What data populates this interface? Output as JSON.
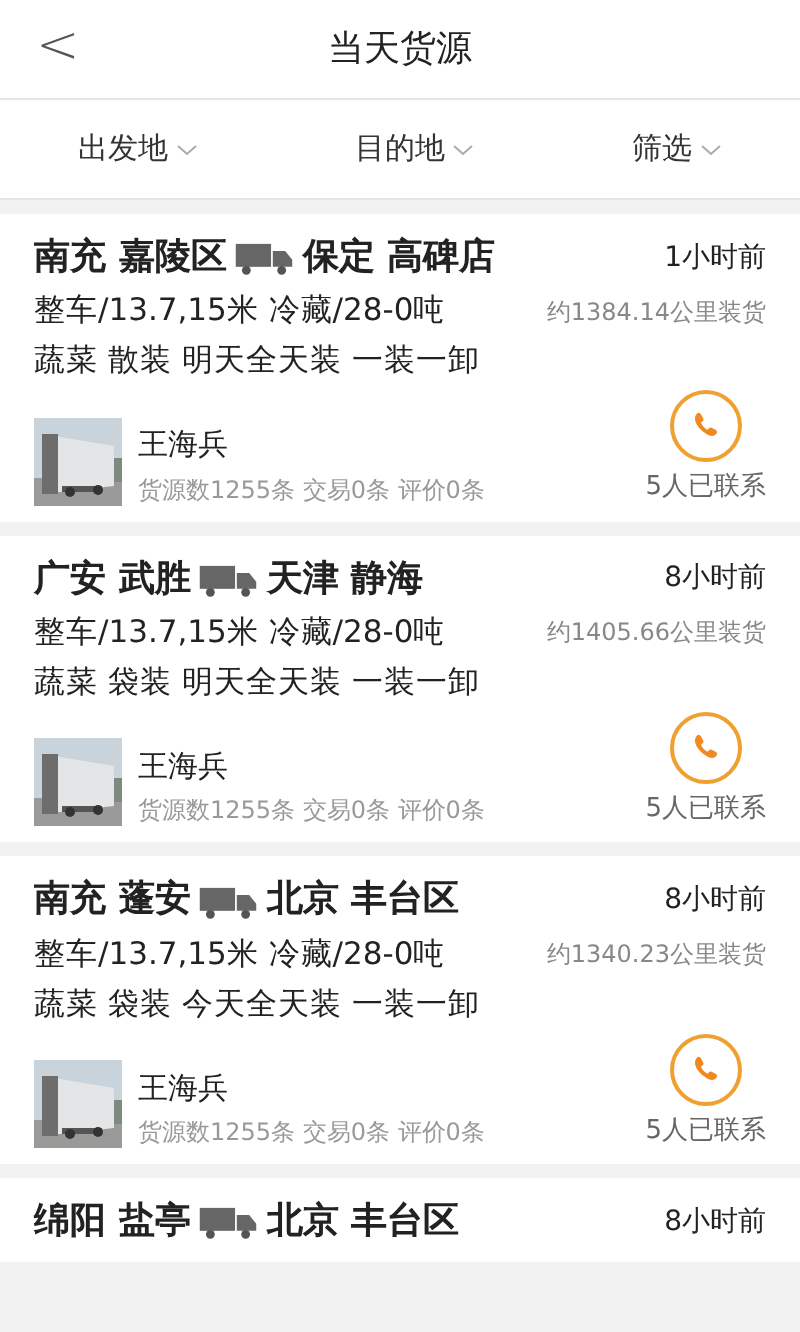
{
  "header": {
    "back": "<",
    "title": "当天货源"
  },
  "filters": [
    {
      "label": "出发地"
    },
    {
      "label": "目的地"
    },
    {
      "label": "筛选"
    }
  ],
  "cargo": [
    {
      "from": "南充 嘉陵区",
      "to": "保定 高碑店",
      "time": "1小时前",
      "spec": "整车/13.7,15米 冷藏/28-0吨",
      "distance": "约1384.14公里装货",
      "tags": "蔬菜 散装 明天全天装 一装一卸",
      "driver": "王海兵",
      "stats": "货源数1255条 交易0条 评价0条",
      "contacted": "5人已联系"
    },
    {
      "from": "广安 武胜",
      "to": "天津 静海",
      "time": "8小时前",
      "spec": "整车/13.7,15米 冷藏/28-0吨",
      "distance": "约1405.66公里装货",
      "tags": "蔬菜 袋装 明天全天装 一装一卸",
      "driver": "王海兵",
      "stats": "货源数1255条 交易0条 评价0条",
      "contacted": "5人已联系"
    },
    {
      "from": "南充 蓬安",
      "to": "北京 丰台区",
      "time": "8小时前",
      "spec": "整车/13.7,15米 冷藏/28-0吨",
      "distance": "约1340.23公里装货",
      "tags": "蔬菜 袋装 今天全天装 一装一卸",
      "driver": "王海兵",
      "stats": "货源数1255条 交易0条 评价0条",
      "contacted": "5人已联系"
    },
    {
      "from": "绵阳 盐亭",
      "to": "北京 丰台区",
      "time": "8小时前"
    }
  ]
}
